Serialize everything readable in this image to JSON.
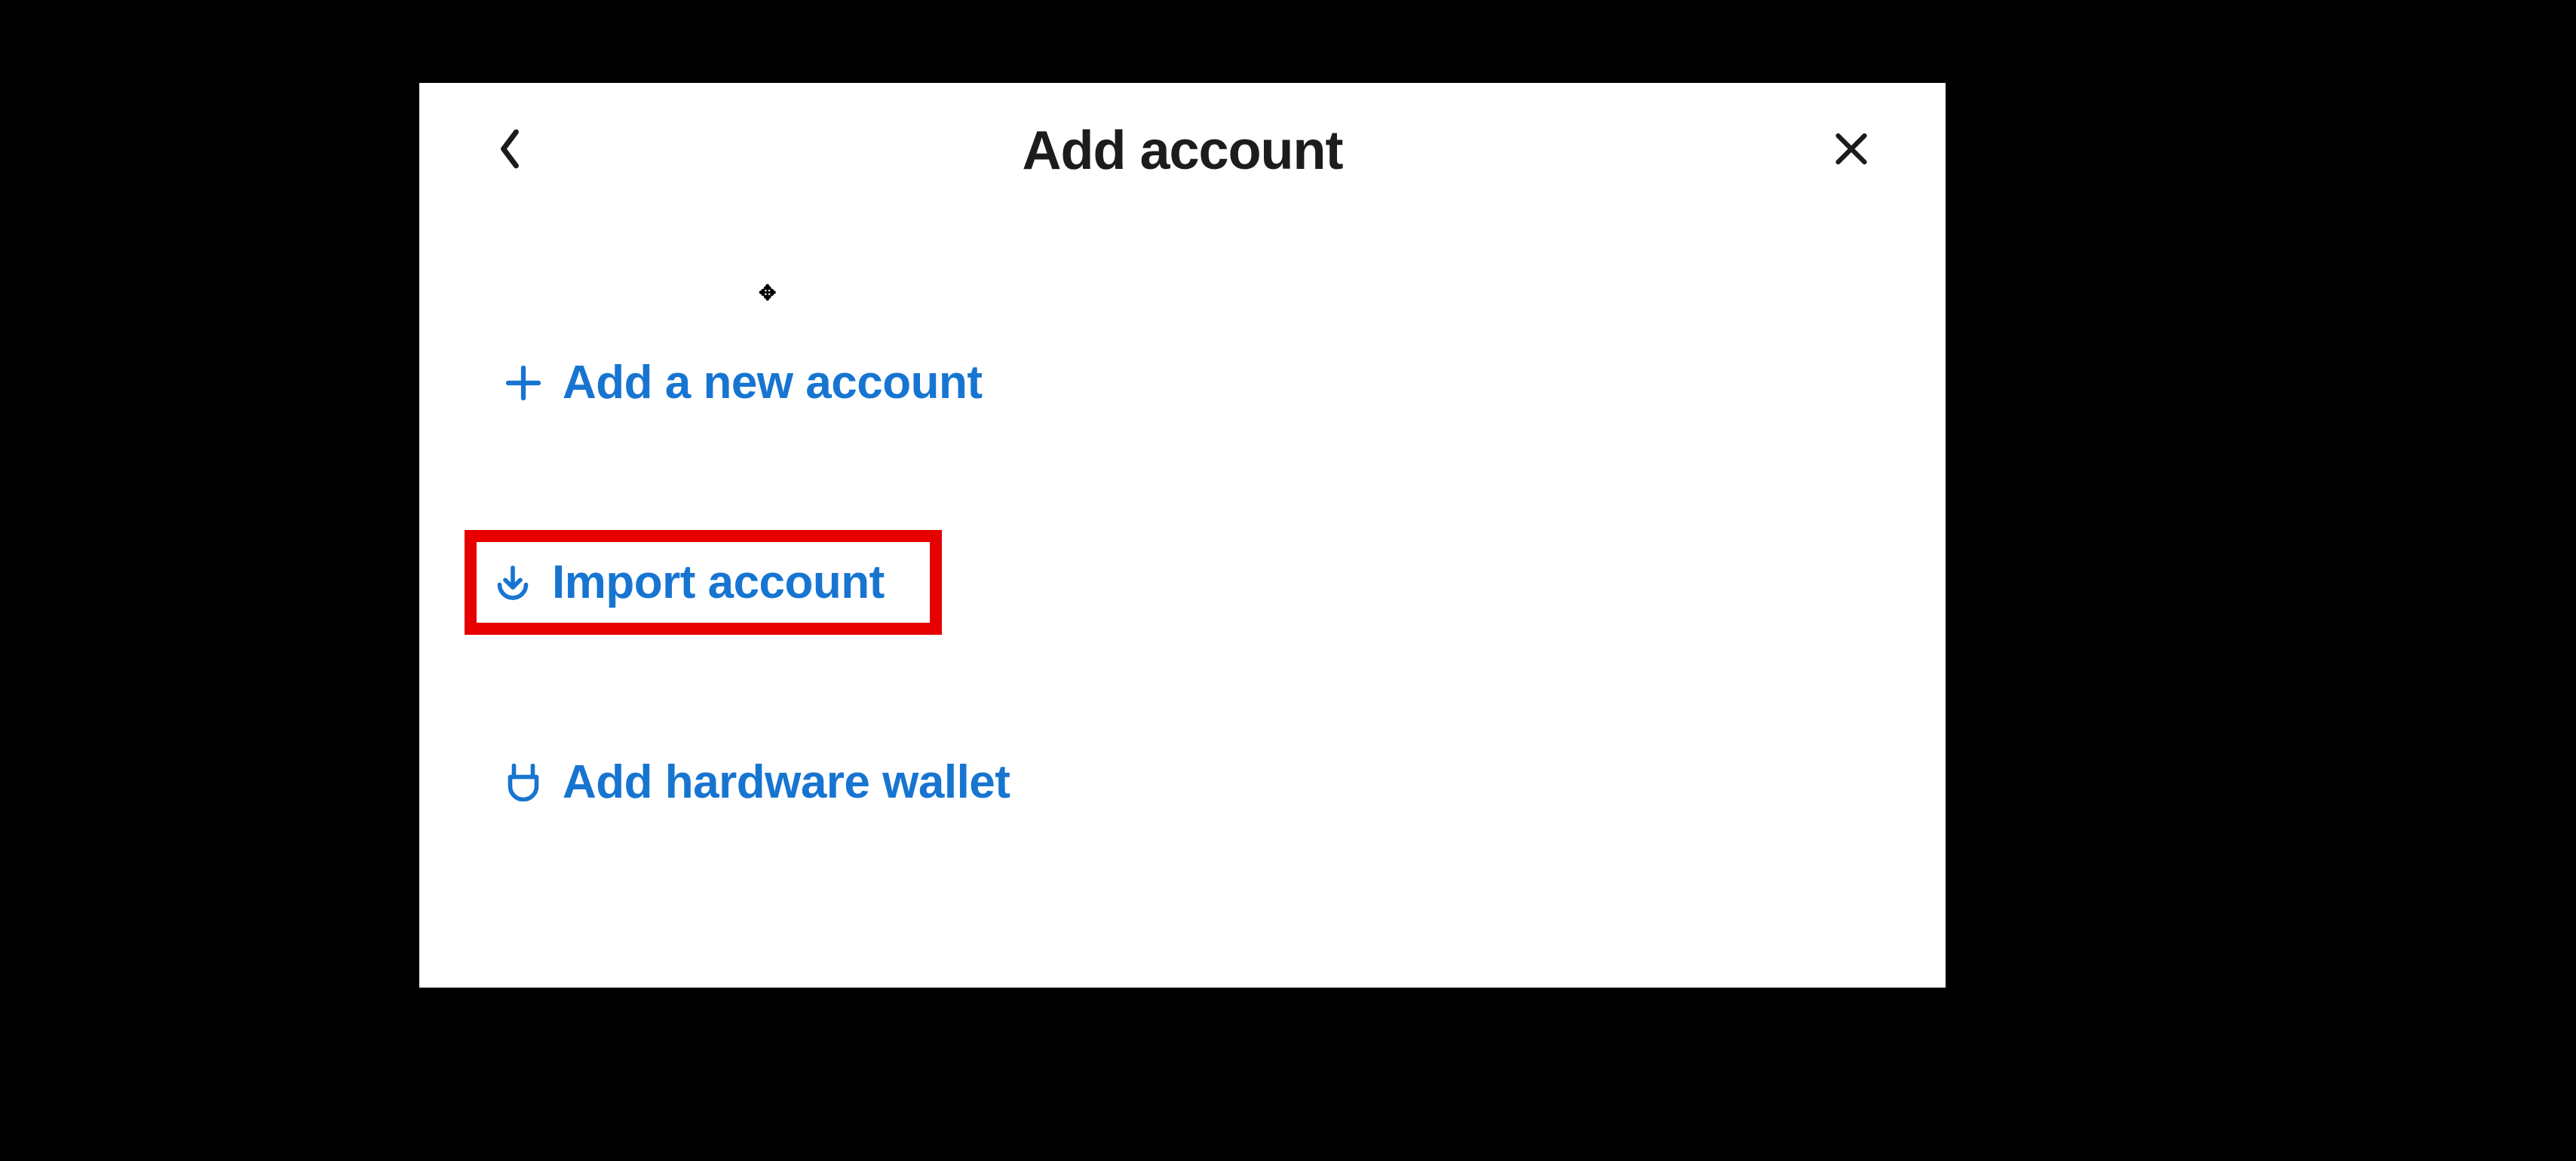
{
  "header": {
    "title": "Add account"
  },
  "options": [
    {
      "label": "Add a new account",
      "highlighted": false
    },
    {
      "label": "Import account",
      "highlighted": true
    },
    {
      "label": "Add hardware wallet",
      "highlighted": false
    }
  ],
  "colors": {
    "accent": "#1775d1",
    "highlight_border": "#e60000",
    "text_dark": "#1c1c1c"
  }
}
